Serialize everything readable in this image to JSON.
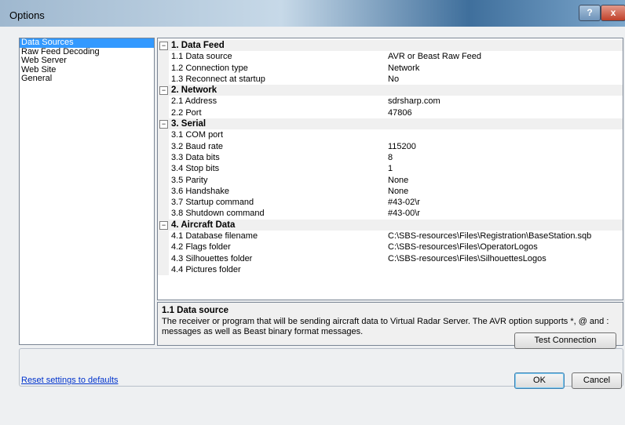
{
  "window": {
    "title": "Options"
  },
  "titlebar": {
    "help_glyph": "?",
    "close_glyph": "x"
  },
  "sidebar": {
    "items": [
      {
        "label": "Data Sources",
        "selected": true
      },
      {
        "label": "Raw Feed Decoding"
      },
      {
        "label": "Web Server"
      },
      {
        "label": "Web Site"
      },
      {
        "label": "General"
      }
    ]
  },
  "property_grid": {
    "toggle_glyph": "−",
    "categories": [
      {
        "label": "1. Data Feed",
        "rows": [
          {
            "name": "1.1 Data source",
            "value": "AVR or Beast Raw Feed"
          },
          {
            "name": "1.2 Connection type",
            "value": "Network"
          },
          {
            "name": "1.3 Reconnect at startup",
            "value": "No"
          }
        ]
      },
      {
        "label": "2. Network",
        "rows": [
          {
            "name": "2.1 Address",
            "value": "sdrsharp.com"
          },
          {
            "name": "2.2 Port",
            "value": "47806"
          }
        ]
      },
      {
        "label": "3. Serial",
        "rows": [
          {
            "name": "3.1 COM port",
            "value": ""
          },
          {
            "name": "3.2 Baud rate",
            "value": "115200"
          },
          {
            "name": "3.3 Data bits",
            "value": "8"
          },
          {
            "name": "3.4 Stop bits",
            "value": "1"
          },
          {
            "name": "3.5 Parity",
            "value": "None"
          },
          {
            "name": "3.6 Handshake",
            "value": "None"
          },
          {
            "name": "3.7 Startup command",
            "value": "#43-02\\r"
          },
          {
            "name": "3.8 Shutdown command",
            "value": "#43-00\\r"
          }
        ]
      },
      {
        "label": "4. Aircraft Data",
        "rows": [
          {
            "name": "4.1 Database filename",
            "value": "C:\\SBS-resources\\Files\\Registration\\BaseStation.sqb"
          },
          {
            "name": "4.2 Flags folder",
            "value": "C:\\SBS-resources\\Files\\OperatorLogos"
          },
          {
            "name": "4.3 Silhouettes folder",
            "value": "C:\\SBS-resources\\Files\\SilhouettesLogos"
          },
          {
            "name": "4.4 Pictures folder",
            "value": ""
          }
        ]
      }
    ]
  },
  "description": {
    "title": "1.1 Data source",
    "text": "The receiver or program that will be sending aircraft data to Virtual Radar Server. The AVR option supports *, @ and : messages as well as Beast binary format messages."
  },
  "buttons": {
    "test_connection": "Test Connection",
    "ok": "OK",
    "cancel": "Cancel"
  },
  "reset_link": "Reset settings to defaults"
}
